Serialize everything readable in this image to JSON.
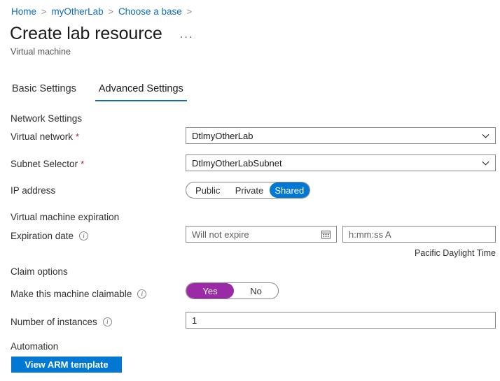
{
  "breadcrumb": {
    "items": [
      "Home",
      "myOtherLab",
      "Choose a base"
    ],
    "separator": ">"
  },
  "header": {
    "title": "Create lab resource",
    "subtitle": "Virtual machine",
    "more_menu": "···"
  },
  "tabs": [
    {
      "label": "Basic Settings",
      "active": false
    },
    {
      "label": "Advanced Settings",
      "active": true
    }
  ],
  "sections": {
    "network": {
      "heading": "Network Settings",
      "virtual_network": {
        "label": "Virtual network",
        "required": "*",
        "value": "DtlmyOtherLab"
      },
      "subnet_selector": {
        "label": "Subnet Selector",
        "required": "*",
        "value": "DtlmyOtherLabSubnet"
      },
      "ip_address": {
        "label": "IP address",
        "options": [
          "Public",
          "Private",
          "Shared"
        ],
        "selected": "Shared"
      }
    },
    "expiration": {
      "heading": "Virtual machine expiration",
      "expiration_date": {
        "label": "Expiration date",
        "date_placeholder": "Will not expire",
        "date_value": "",
        "time_placeholder": "h:mm:ss A",
        "time_value": "",
        "timezone": "Pacific Daylight Time"
      }
    },
    "claim": {
      "heading": "Claim options",
      "claimable": {
        "label": "Make this machine claimable",
        "options": [
          "Yes",
          "No"
        ],
        "selected": "Yes"
      },
      "instances": {
        "label": "Number of instances",
        "value": "1"
      }
    },
    "automation": {
      "heading": "Automation",
      "view_arm_button": "View ARM template"
    }
  },
  "colors": {
    "link": "#0f6cbd",
    "accent": "#0078d4",
    "toggle_on_purple": "#9b2aa8",
    "required_red": "#a4262c",
    "border": "#8a8886"
  }
}
